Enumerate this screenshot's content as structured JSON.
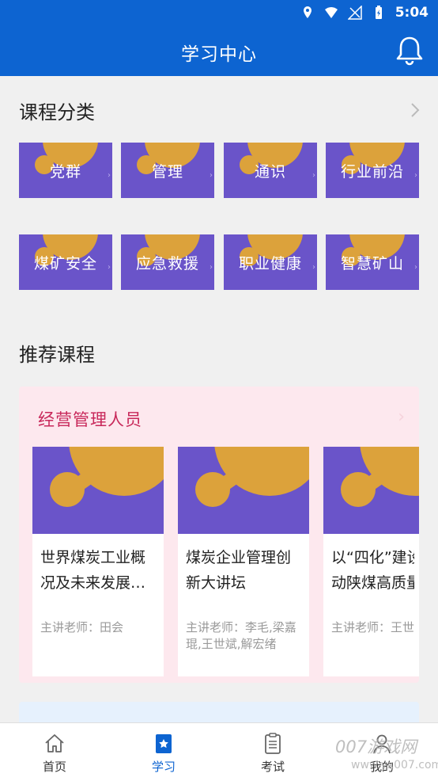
{
  "status": {
    "time": "5:04"
  },
  "header": {
    "title": "学习中心",
    "notification_icon": "bell-icon"
  },
  "categories": {
    "title": "课程分类",
    "items": [
      {
        "label": "党群"
      },
      {
        "label": "管理"
      },
      {
        "label": "通识"
      },
      {
        "label": "行业前沿"
      },
      {
        "label": "煤矿安全"
      },
      {
        "label": "应急救援"
      },
      {
        "label": "职业健康"
      },
      {
        "label": "智慧矿山"
      }
    ]
  },
  "recommend": {
    "title": "推荐课程",
    "panel": {
      "title": "经营管理人员",
      "courses": [
        {
          "title_line1": "世界煤炭工业概",
          "title_line2": "况及未来发展…",
          "teacher": "主讲老师：田会"
        },
        {
          "title_line1": "煤炭企业管理创",
          "title_line2": "新大讲坛",
          "teacher": "主讲老师：李毛,梁嘉琨,王世斌,解宏绪"
        },
        {
          "title_line1": "以“四化”建设",
          "title_line2": "动陕煤高质量",
          "teacher": "主讲老师：王世"
        }
      ]
    }
  },
  "nav": {
    "items": [
      {
        "label": "首页",
        "icon": "home-icon"
      },
      {
        "label": "学习",
        "icon": "study-icon"
      },
      {
        "label": "考试",
        "icon": "exam-icon"
      },
      {
        "label": "我的",
        "icon": "profile-icon"
      }
    ],
    "active": "学习"
  },
  "watermark": {
    "line1": "007游戏网",
    "line2": "www.yx007.com"
  },
  "colors": {
    "primary": "#0d64d1",
    "card_purple": "#6a54c9",
    "card_gold": "#dca23b",
    "panel_pink": "#fde8ee",
    "panel_title": "#c8285a"
  }
}
